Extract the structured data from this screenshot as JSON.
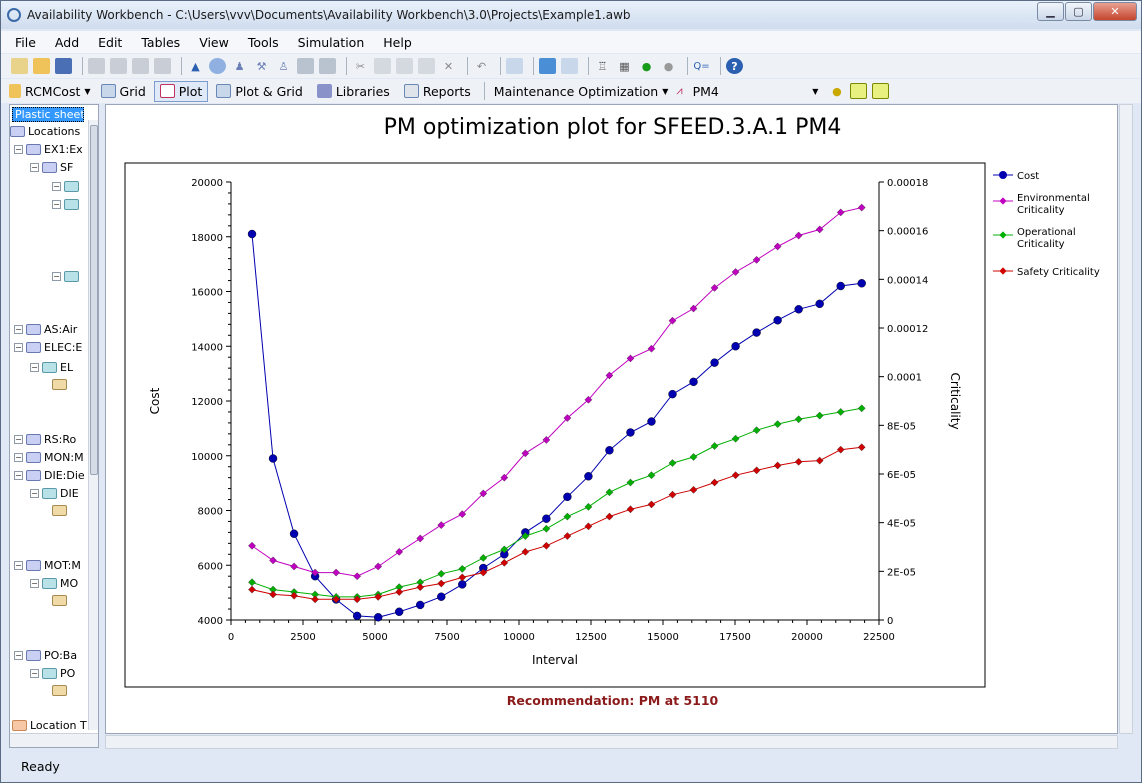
{
  "window": {
    "title": "Availability Workbench - C:\\Users\\vvv\\Documents\\Availability Workbench\\3.0\\Projects\\Example1.awb"
  },
  "menu": [
    "File",
    "Add",
    "Edit",
    "Tables",
    "View",
    "Tools",
    "Simulation",
    "Help"
  ],
  "toolbar2": {
    "rcm": "RCMCost",
    "grid": "Grid",
    "plot": "Plot",
    "plot_grid": "Plot & Grid",
    "libraries": "Libraries",
    "reports": "Reports",
    "mode": "Maintenance Optimization",
    "pm": "PM4"
  },
  "sidebar": {
    "selected": "Plastic sheet e",
    "items": [
      {
        "label": "Locations",
        "icon": "node"
      },
      {
        "label": "EX1:Ex",
        "icon": "node"
      },
      {
        "label": "SF",
        "icon": "node"
      },
      {
        "label": "",
        "icon": "teal"
      },
      {
        "label": "",
        "icon": "teal"
      },
      {
        "label": "",
        "icon": "teal"
      },
      {
        "label": "AS:Air",
        "icon": "node"
      },
      {
        "label": "ELEC:E",
        "icon": "node"
      },
      {
        "label": "EL",
        "icon": "teal"
      },
      {
        "label": "",
        "icon": "tan"
      },
      {
        "label": "RS:Ro",
        "icon": "node"
      },
      {
        "label": "MON:M",
        "icon": "node"
      },
      {
        "label": "DIE:Die",
        "icon": "node"
      },
      {
        "label": "DIE",
        "icon": "teal"
      },
      {
        "label": "",
        "icon": "tan"
      },
      {
        "label": "MOT:M",
        "icon": "node"
      },
      {
        "label": "MO",
        "icon": "teal"
      },
      {
        "label": "",
        "icon": "tan"
      },
      {
        "label": "PO:Ba",
        "icon": "node"
      },
      {
        "label": "PO",
        "icon": "teal"
      },
      {
        "label": "",
        "icon": "tan"
      },
      {
        "label": "Location T",
        "icon": "orange"
      }
    ]
  },
  "plot": {
    "title": "PM optimization plot for SFEED.3.A.1 PM4",
    "recommendation": "Recommendation: PM at 5110"
  },
  "status": "Ready",
  "chart_data": {
    "type": "line",
    "title": "PM optimization plot for SFEED.3.A.1 PM4",
    "xlabel": "Interval",
    "ylabel": "Cost",
    "y2label": "Criticality",
    "xlim": [
      0,
      22500
    ],
    "ylim": [
      4000,
      20000
    ],
    "y2lim": [
      0,
      0.00018
    ],
    "xticks": [
      "0",
      "2500",
      "5000",
      "7500",
      "10000",
      "12500",
      "15000",
      "17500",
      "20000",
      "22500"
    ],
    "yticks": [
      "4000",
      "6000",
      "8000",
      "10000",
      "12000",
      "14000",
      "16000",
      "18000",
      "20000"
    ],
    "y2ticks": [
      "0",
      "2E-05",
      "4E-05",
      "6E-05",
      "8E-05",
      "0.0001",
      "0.00012",
      "0.00014",
      "0.00016",
      "0.00018"
    ],
    "x": [
      730,
      1460,
      2190,
      2920,
      3650,
      4380,
      5110,
      5840,
      6570,
      7300,
      8030,
      8760,
      9490,
      10220,
      10950,
      11680,
      12410,
      13140,
      13870,
      14600,
      15330,
      16060,
      16790,
      17520,
      18250,
      18980,
      19710,
      20440,
      21170,
      21900
    ],
    "series": [
      {
        "name": "Cost",
        "axis": "y",
        "color": "#0000b0",
        "marker": "circle",
        "values": [
          18100,
          9900,
          7150,
          5600,
          4750,
          4150,
          4100,
          4300,
          4550,
          4850,
          5300,
          5900,
          6400,
          7200,
          7700,
          8500,
          9250,
          10200,
          10850,
          11250,
          12250,
          12700,
          13400,
          14000,
          14500,
          14950,
          15350,
          15550,
          16200,
          16300
        ]
      },
      {
        "name": "Environmental Criticality",
        "axis": "y2",
        "color": "#c000c0",
        "marker": "diamond",
        "values": [
          3.05e-05,
          2.45e-05,
          2.2e-05,
          1.95e-05,
          1.95e-05,
          1.8e-05,
          2.2e-05,
          2.8e-05,
          3.35e-05,
          3.9e-05,
          4.35e-05,
          5.2e-05,
          5.85e-05,
          6.85e-05,
          7.4e-05,
          8.3e-05,
          9.05e-05,
          0.0001005,
          0.0001075,
          0.0001115,
          0.000123,
          0.000128,
          0.0001365,
          0.000143,
          0.000148,
          0.0001535,
          0.000158,
          0.0001605,
          0.0001675,
          0.0001695
        ]
      },
      {
        "name": "Operational Criticality",
        "axis": "y2",
        "color": "#00b000",
        "marker": "diamond",
        "values": [
          1.55e-05,
          1.25e-05,
          1.15e-05,
          1.05e-05,
          9.5e-06,
          9.5e-06,
          1.05e-05,
          1.35e-05,
          1.55e-05,
          1.9e-05,
          2.1e-05,
          2.55e-05,
          2.9e-05,
          3.45e-05,
          3.75e-05,
          4.25e-05,
          4.65e-05,
          5.25e-05,
          5.65e-05,
          5.95e-05,
          6.45e-05,
          6.7e-05,
          7.15e-05,
          7.45e-05,
          7.8e-05,
          8.05e-05,
          8.25e-05,
          8.4e-05,
          8.55e-05,
          8.7e-05
        ]
      },
      {
        "name": "Safety Criticality",
        "axis": "y2",
        "color": "#d00000",
        "marker": "diamond",
        "values": [
          1.25e-05,
          1.05e-05,
          1e-05,
          8.5e-06,
          8.5e-06,
          8.5e-06,
          9.5e-06,
          1.15e-05,
          1.35e-05,
          1.5e-05,
          1.75e-05,
          1.95e-05,
          2.35e-05,
          2.8e-05,
          3.05e-05,
          3.45e-05,
          3.85e-05,
          4.25e-05,
          4.55e-05,
          4.75e-05,
          5.15e-05,
          5.35e-05,
          5.65e-05,
          5.95e-05,
          6.15e-05,
          6.35e-05,
          6.5e-05,
          6.55e-05,
          7e-05,
          7.1e-05
        ]
      }
    ],
    "legend_position": "right"
  }
}
